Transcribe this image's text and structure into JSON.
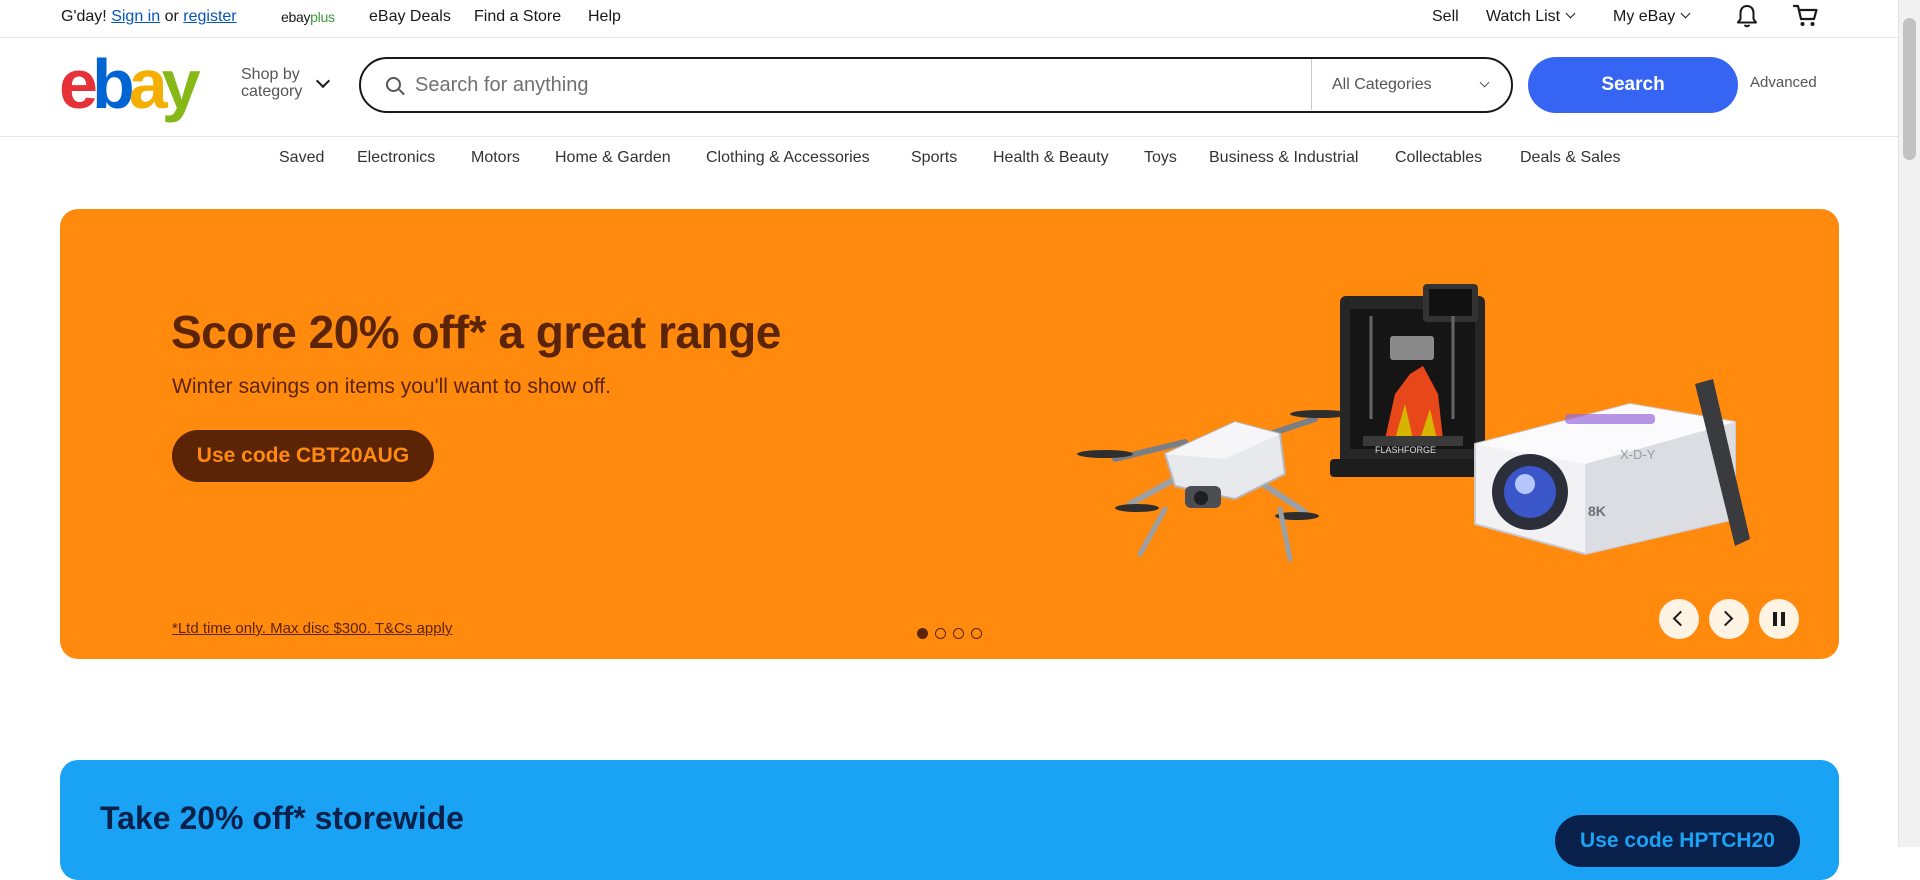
{
  "topbar": {
    "greeting": "G'day!",
    "sign_in": "Sign in",
    "or": "or",
    "register": "register",
    "ebayplus_a": "ebay",
    "ebayplus_b": "plus",
    "deals": "eBay Deals",
    "find_store": "Find a Store",
    "help": "Help",
    "sell": "Sell",
    "watch_list": "Watch List",
    "my_ebay": "My eBay"
  },
  "header": {
    "logo": [
      "e",
      "b",
      "a",
      "y"
    ],
    "shop_by_1": "Shop by",
    "shop_by_2": "category",
    "search_placeholder": "Search for anything",
    "category_select": "All Categories",
    "search_button": "Search",
    "advanced": "Advanced"
  },
  "nav": [
    "Saved",
    "Electronics",
    "Motors",
    "Home & Garden",
    "Clothing & Accessories",
    "Sports",
    "Health & Beauty",
    "Toys",
    "Business & Industrial",
    "Collectables",
    "Deals & Sales"
  ],
  "hero": {
    "title": "Score 20% off* a great range",
    "subtitle": "Winter savings on items you'll want to show off.",
    "cta": "Use code CBT20AUG",
    "fine_print": "*Ltd time only. Max disc $300. T&Cs apply",
    "active_slide": 1,
    "slide_count": 4,
    "bg_color": "#ff8a0d",
    "text_color": "#5c2407",
    "product_labels": [
      "FLASHFORGE",
      "X-D-Y",
      "8K"
    ]
  },
  "banner2": {
    "title": "Take 20% off* storewide",
    "cta": "Use code HPTCH20",
    "bg_color": "#1aa3f5"
  },
  "colors": {
    "accent": "#3665f3",
    "link": "#0654ba"
  }
}
